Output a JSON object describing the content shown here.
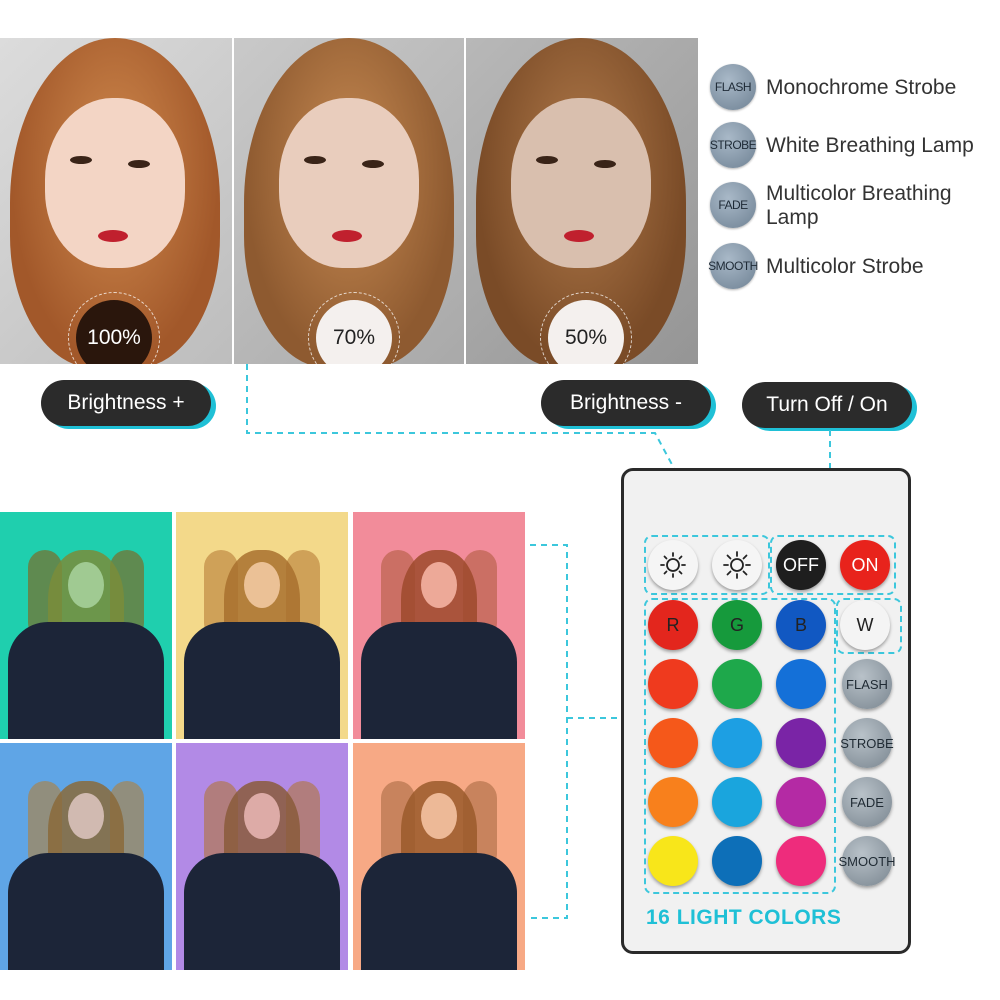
{
  "brightness_photos": [
    {
      "label": "100%"
    },
    {
      "label": "70%"
    },
    {
      "label": "50%"
    }
  ],
  "modes": [
    {
      "badge": "FLASH",
      "label": "Monochrome Strobe"
    },
    {
      "badge": "STROBE",
      "label": "White Breathing Lamp"
    },
    {
      "badge": "FADE",
      "label": "Multicolor Breathing Lamp"
    },
    {
      "badge": "SMOOTH",
      "label": "Multicolor Strobe"
    }
  ],
  "pills": {
    "brightness_up": "Brightness +",
    "brightness_down": "Brightness -",
    "power": "Turn Off / On"
  },
  "color_photos": [
    {
      "bg": "#1fcfae"
    },
    {
      "bg": "#f3d98a"
    },
    {
      "bg": "#f28c9a"
    },
    {
      "bg": "#5fa5e6"
    },
    {
      "bg": "#b28ae6"
    },
    {
      "bg": "#f7a985"
    }
  ],
  "remote": {
    "top_row": [
      {
        "icon": "brightness-down-icon",
        "label": ""
      },
      {
        "icon": "brightness-up-icon",
        "label": ""
      },
      {
        "label": "OFF",
        "color": "#1e1e1e",
        "text": "#ffffff"
      },
      {
        "label": "ON",
        "color": "#e8231c",
        "text": "#ffffff"
      }
    ],
    "rgbw": [
      {
        "label": "R",
        "color": "#e3261d"
      },
      {
        "label": "G",
        "color": "#169a3c"
      },
      {
        "label": "B",
        "color": "#1158c2"
      },
      {
        "label": "W",
        "color": "#f4f4f4"
      }
    ],
    "color_rows": [
      [
        "#ef3a1e",
        "#1ea84b",
        "#1470d8"
      ],
      [
        "#f5581a",
        "#1d9fe3",
        "#7a24a6"
      ],
      [
        "#f8801c",
        "#1aa5dd",
        "#b42aa4"
      ],
      [
        "#f8e61a",
        "#0d6fb8",
        "#ee2c7c"
      ]
    ],
    "mode_buttons": [
      "FLASH",
      "STROBE",
      "FADE",
      "SMOOTH"
    ],
    "caption": "16 LIGHT COLORS"
  },
  "colors": {
    "accent": "#1fc0d6",
    "pill_bg": "#2b2b2b"
  }
}
